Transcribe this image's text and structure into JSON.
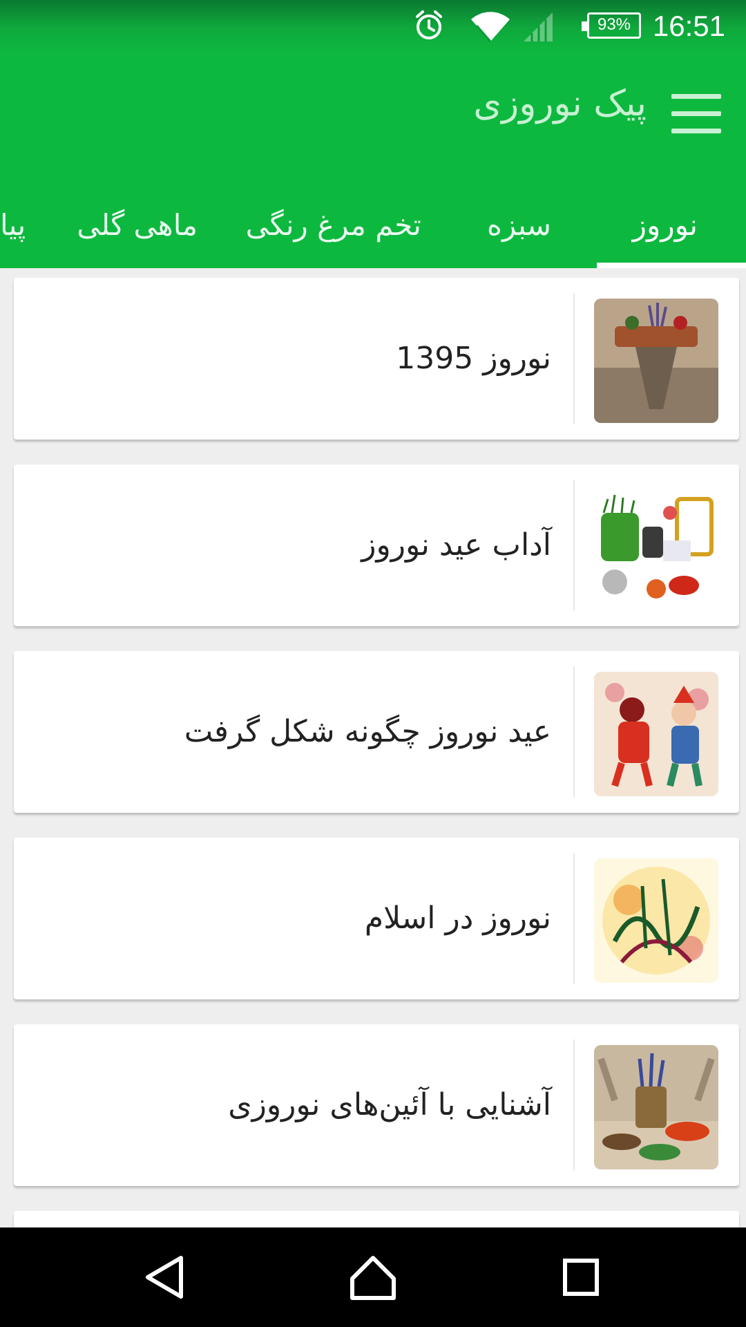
{
  "status_bar": {
    "time": "16:51",
    "battery": "93%",
    "icons": [
      "alarm-icon",
      "wifi-icon",
      "signal-icon",
      "battery-icon"
    ]
  },
  "app_bar": {
    "title": "پیک نوروزی",
    "menu_icon": "hamburger-menu-icon",
    "background": "#0db83f"
  },
  "tabs": [
    {
      "label": "نوروز",
      "active": true
    },
    {
      "label": "سبزه",
      "active": false
    },
    {
      "label": "تخم مرغ رنگی",
      "active": false
    },
    {
      "label": "ماهی گلی",
      "active": false
    },
    {
      "label": "پیا",
      "active": false
    }
  ],
  "cards": [
    {
      "title": "نوروز 1395",
      "image": "persepolis-haftsin-thumbnail"
    },
    {
      "title": "آداب عید نوروز",
      "image": "haftsin-table-thumbnail"
    },
    {
      "title": "عید نوروز چگونه شکل گرفت",
      "image": "haji-firuz-thumbnail"
    },
    {
      "title": "نوروز در اسلام",
      "image": "calligraphy-thumbnail"
    },
    {
      "title": "آشنایی با آئین‌های نوروزی",
      "image": "haftsin-spread-thumbnail"
    }
  ],
  "nav_bar": {
    "buttons": [
      "back-icon",
      "home-icon",
      "recents-icon"
    ]
  }
}
